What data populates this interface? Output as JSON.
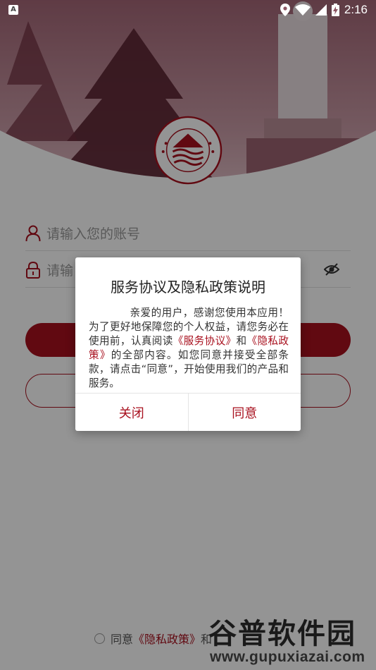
{
  "status_bar": {
    "notification_badge": "A",
    "time": "2:16",
    "icons": [
      "location-icon",
      "wifi-icon",
      "signal-icon",
      "battery-charging-icon"
    ]
  },
  "login": {
    "account_placeholder": "请输入您的账号",
    "password_placeholder": "请输",
    "agree_prefix": "同意",
    "agree_link": "《隐私政策》",
    "agree_suffix": "和"
  },
  "dialog": {
    "title": "服务协议及隐私政策说明",
    "body_part1": "亲爱的用户，感谢您使用本应用！为了更好地保障您的个人权益，请您务必在使用前，认真阅读",
    "link_service": "《服务协议》",
    "body_and": "和",
    "link_privacy": "《隐私政策》",
    "body_part2": "的全部内容。如您同意并接受全部条款，请点击“同意”，开始使用我们的产品和服务。",
    "close_label": "关闭",
    "agree_label": "同意"
  },
  "watermark": {
    "cn": "谷普软件园",
    "url": "www.gupuxiazai.com"
  },
  "colors": {
    "accent": "#a8101e",
    "scrim": "rgba(0,0,0,0.42)"
  }
}
